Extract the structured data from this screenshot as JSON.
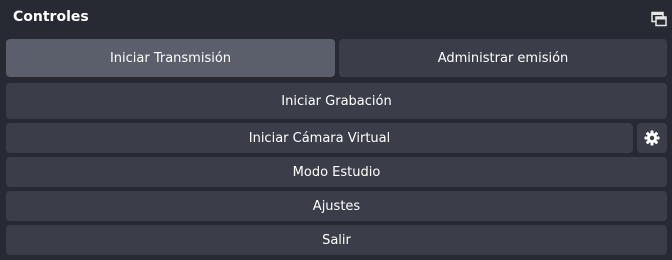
{
  "dock": {
    "title": "Controles",
    "float_icon": "undock-window-icon"
  },
  "controls": {
    "start_streaming": "Iniciar Transmisión",
    "manage_broadcast": "Administrar emisión",
    "start_recording": "Iniciar Grabación",
    "start_virtual_camera": "Iniciar Cámara Virtual",
    "virtual_camera_settings_icon": "gear-icon",
    "studio_mode": "Modo Estudio",
    "settings": "Ajustes",
    "exit": "Salir"
  },
  "colors": {
    "background": "#272a33",
    "button": "#3b3e49",
    "button_active": "#5b5f6c",
    "text": "#ffffff"
  }
}
